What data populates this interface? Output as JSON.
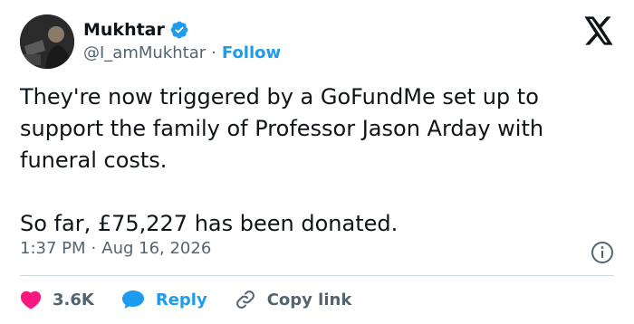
{
  "author": {
    "name": "Mukhtar",
    "handle": "@I_amMukhtar",
    "separator": "·",
    "follow_label": "Follow"
  },
  "tweet": {
    "text": "They're now triggered by a GoFundMe set up to support the family of Professor Jason Arday with funeral costs.\n\nSo far, £75,227 has been donated.",
    "time": "1:37 PM",
    "separator": "·",
    "date": "Aug 16, 2026"
  },
  "actions": {
    "likes": "3.6K",
    "reply_label": "Reply",
    "copy_label": "Copy link"
  },
  "colors": {
    "accent": "#1d9bf0",
    "heart": "#f91880",
    "text": "#0f1419",
    "muted": "#536471"
  },
  "icons": [
    "verified-badge-icon",
    "x-logo-icon",
    "info-icon",
    "heart-icon",
    "reply-bubble-icon",
    "link-icon"
  ]
}
